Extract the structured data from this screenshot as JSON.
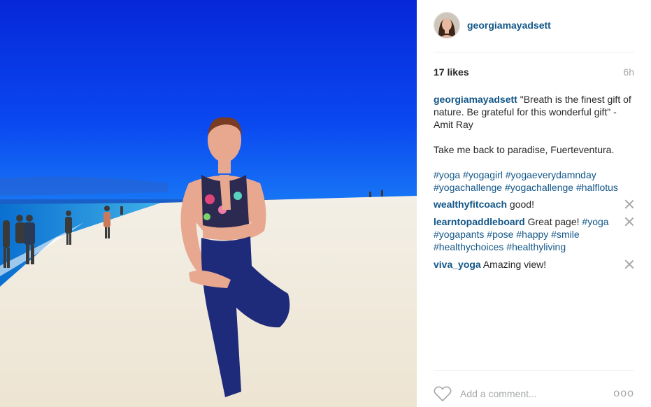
{
  "post": {
    "username": "georgiamayadsett",
    "likes": "17 likes",
    "time": "6h"
  },
  "caption": {
    "username": "georgiamayadsett",
    "line1": "\"Breath is the finest gift of nature. Be grateful for this wonderful gift\" - Amit Ray",
    "line2": "Take me back to paradise, Fuerteventura.",
    "tags": [
      "#yoga",
      "#yogagirl",
      "#yogaeverydamnday",
      "#yogachallenge",
      "#yogachallenge",
      "#halflotus"
    ]
  },
  "comments": [
    {
      "username": "wealthyfitcoach",
      "text": "good!",
      "tags": []
    },
    {
      "username": "learntopaddleboard",
      "text": "Great page!",
      "tags": [
        "#yoga",
        "#yogapants",
        "#pose",
        "#happy",
        "#smile",
        "#healthychoices",
        "#healthyliving"
      ]
    },
    {
      "username": "viva_yoga",
      "text": "Amazing view!",
      "tags": []
    }
  ],
  "footer": {
    "placeholder": "Add a comment...",
    "more": "ooo"
  },
  "icons": {
    "like": "heart-outline-icon",
    "delete": "close-icon",
    "more": "more-options-icon"
  },
  "colors": {
    "link": "#125688",
    "muted": "#a5a7aa",
    "text": "#262626",
    "sky": "#0a3fe0"
  }
}
